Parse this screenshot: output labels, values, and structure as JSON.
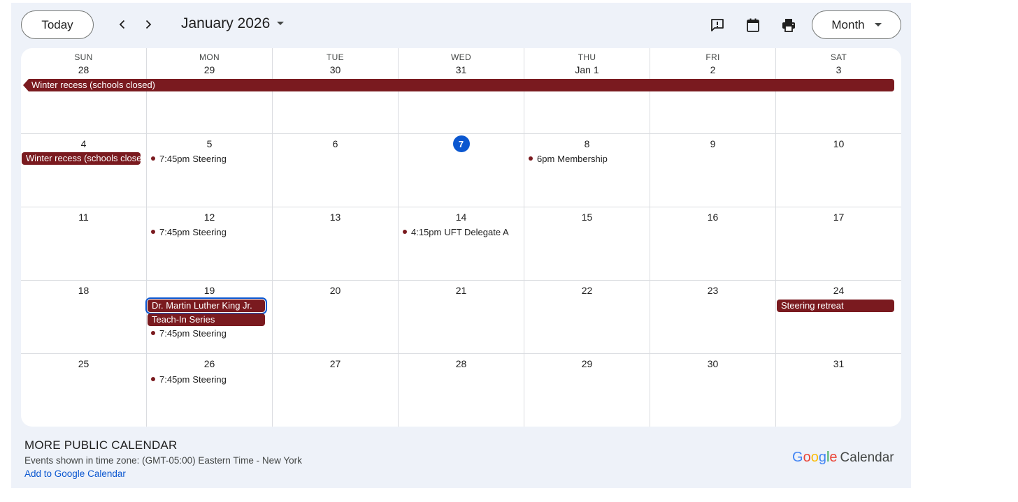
{
  "toolbar": {
    "today_label": "Today",
    "month_title": "January 2026",
    "view_label": "Month",
    "icons": [
      "feedback-icon",
      "calendar-icon",
      "print-icon",
      "chevron-left-icon",
      "chevron-right-icon",
      "caret-down-icon"
    ]
  },
  "weekdays": [
    "SUN",
    "MON",
    "TUE",
    "WED",
    "THU",
    "FRI",
    "SAT"
  ],
  "weeks": [
    [
      "28",
      "29",
      "30",
      "31",
      "Jan 1",
      "2",
      "3"
    ],
    [
      "4",
      "5",
      "6",
      "7",
      "8",
      "9",
      "10"
    ],
    [
      "11",
      "12",
      "13",
      "14",
      "15",
      "16",
      "17"
    ],
    [
      "18",
      "19",
      "20",
      "21",
      "22",
      "23",
      "24"
    ],
    [
      "25",
      "26",
      "27",
      "28",
      "29",
      "30",
      "31"
    ]
  ],
  "today_day": "7",
  "events": {
    "winter_recess_week1": "Winter recess (schools closed)",
    "winter_recess_week2": "Winter recess (schools closed)",
    "steering_5": {
      "time": "7:45pm",
      "title": "Steering"
    },
    "membership_8": {
      "time": "6pm",
      "title": "Membership"
    },
    "steering_12": {
      "time": "7:45pm",
      "title": "Steering"
    },
    "uft_14": {
      "time": "4:15pm",
      "title": "UFT Delegate A"
    },
    "mlk_19": "Dr. Martin Luther King Jr.",
    "teachin_19": "Teach-In Series",
    "steering_19": {
      "time": "7:45pm",
      "title": "Steering"
    },
    "retreat_24": "Steering retreat",
    "steering_26": {
      "time": "7:45pm",
      "title": "Steering"
    }
  },
  "colors": {
    "event": "#7a1a1f",
    "today_badge": "#0b57d0",
    "background": "#eef2f9"
  },
  "footer": {
    "title": "MORE PUBLIC CALENDAR",
    "timezone": "Events shown in time zone: (GMT-05:00) Eastern Time - New York",
    "add_link": "Add to Google Calendar",
    "logo_word": "Calendar"
  }
}
